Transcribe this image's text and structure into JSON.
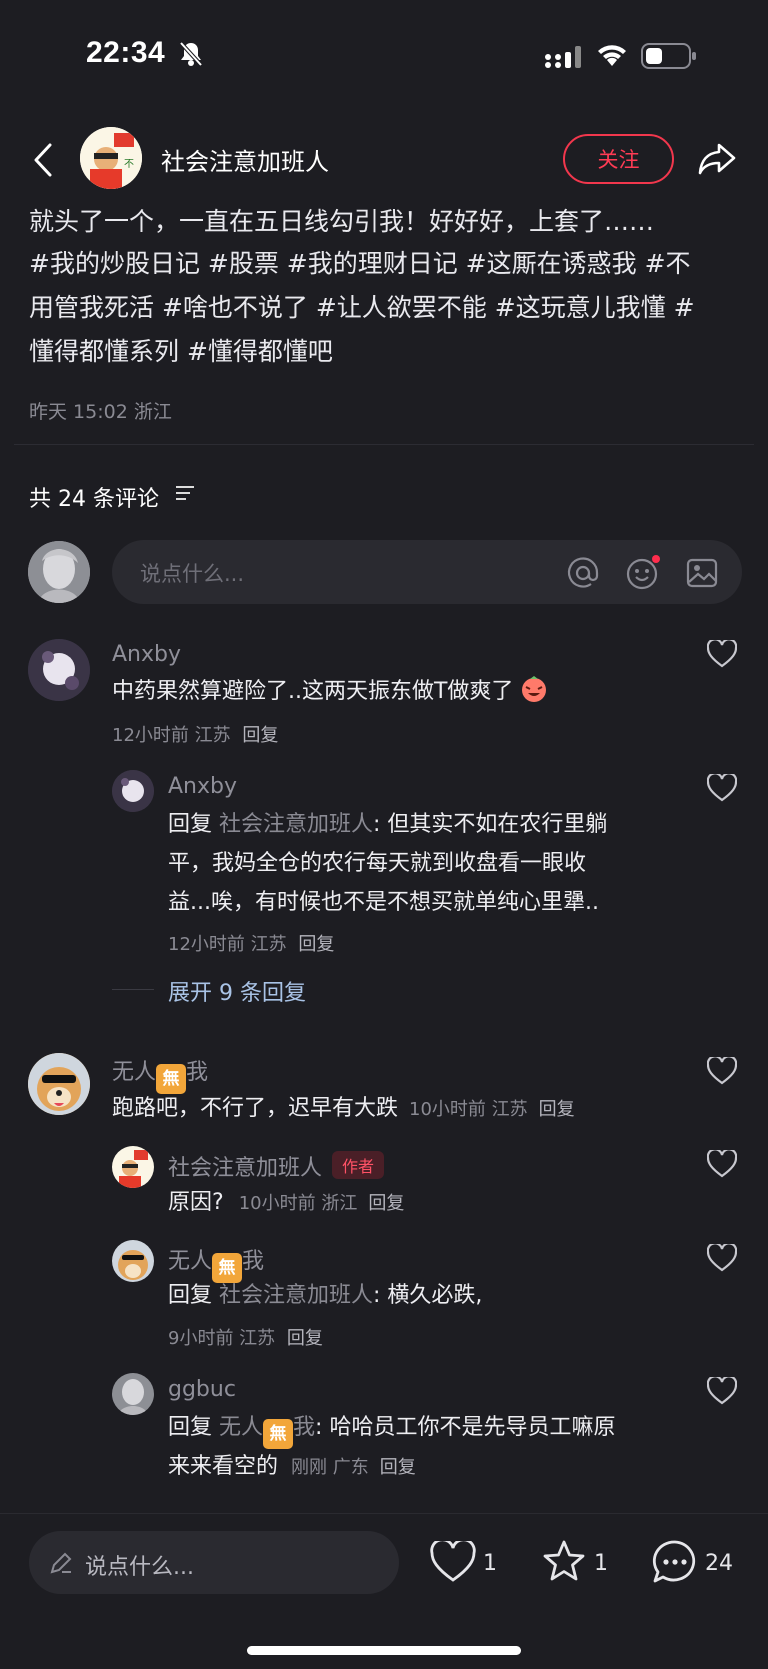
{
  "status_bar": {
    "time": "22:34"
  },
  "header": {
    "user_name": "社会注意加班人",
    "follow_label": "关注"
  },
  "post": {
    "line1": "就头了一个，一直在五日线勾引我！好好好，上套了……",
    "line2": "#我的炒股日记 #股票 #我的理财日记 #这厮在诱惑我 #不",
    "line3": "用管我死活 #啥也不说了 #让人欲罢不能 #这玩意儿我懂 #",
    "line4": "懂得都懂系列 #懂得都懂吧",
    "meta": "昨天 15:02 浙江"
  },
  "comments_header": {
    "title": "共 24 条评论"
  },
  "comment_input": {
    "placeholder": "说点什么..."
  },
  "comments": [
    {
      "name": "Anxby",
      "text": "中药果然算避险了..这两天振东做T做爽了",
      "meta": "12小时前 江苏",
      "reply_label": "回复",
      "replies": [
        {
          "name": "Anxby",
          "prefix": "回复",
          "reply_to": "社会注意加班人",
          "text1": ": 但其实不如在农行里躺",
          "text2": "平，我妈全仓的农行每天就到收盘看一眼收",
          "text3": "益...唉，有时候也不是不想买就单纯心里犟..",
          "meta": "12小时前 江苏",
          "reply_label": "回复"
        }
      ],
      "expand_label": "展开 9 条回复"
    },
    {
      "name_prefix": "无人",
      "name_badge": "無",
      "name_suffix": "我",
      "text": "跑路吧，不行了，迟早有大跌",
      "meta": "10小时前 江苏",
      "reply_label": "回复",
      "replies": [
        {
          "name": "社会注意加班人",
          "author_tag": "作者",
          "text": "原因?",
          "meta": "10小时前 浙江",
          "reply_label": "回复"
        },
        {
          "name_prefix": "无人",
          "name_badge": "無",
          "name_suffix": "我",
          "prefix": "回复",
          "reply_to": "社会注意加班人",
          "text": ": 横久必跌,",
          "meta": "9小时前 江苏",
          "reply_label": "回复"
        },
        {
          "name": "ggbuc",
          "prefix": "回复",
          "reply_to_prefix": "无人",
          "reply_to_badge": "無",
          "reply_to_suffix": "我",
          "text1": ": 哈哈员工你不是先导员工嘛原",
          "text2": "来来看空的",
          "meta": "刚刚 广东",
          "reply_label": "回复"
        }
      ]
    }
  ],
  "bottom_bar": {
    "input_placeholder": "说点什么...",
    "like_count": "1",
    "fav_count": "1",
    "comment_count": "24"
  },
  "colors": {
    "accent": "#ff3b54",
    "background": "#1d1d22",
    "hashtag": "#a9c3e6"
  }
}
